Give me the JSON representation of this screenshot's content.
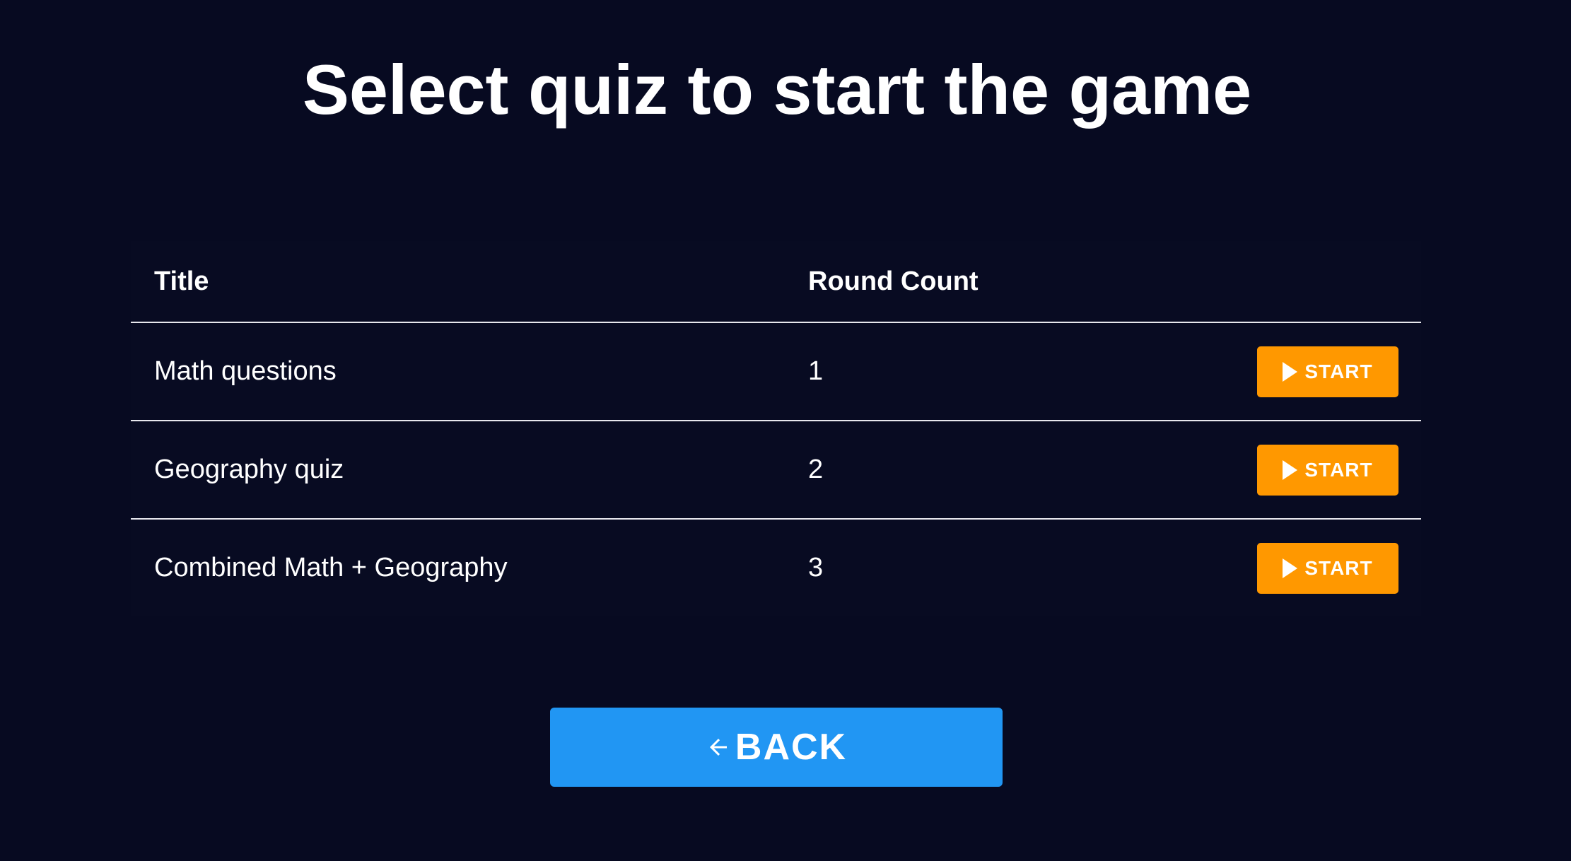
{
  "page": {
    "title": "Select quiz to start the game"
  },
  "table": {
    "headers": {
      "title": "Title",
      "round_count": "Round Count",
      "action": ""
    },
    "rows": [
      {
        "title": "Math questions",
        "round_count": "1",
        "action_label": "START"
      },
      {
        "title": "Geography quiz",
        "round_count": "2",
        "action_label": "START"
      },
      {
        "title": "Combined Math + Geography",
        "round_count": "3",
        "action_label": "START"
      }
    ]
  },
  "back_button": {
    "label": "BACK",
    "icon": "arrow-left-icon"
  },
  "icons": {
    "start": "play-icon",
    "back": "arrow-left-icon"
  },
  "colors": {
    "background": "#070a21",
    "start_button": "#ff9800",
    "back_button": "#2196f3",
    "text": "#ffffff",
    "divider": "#e8e8ee"
  }
}
